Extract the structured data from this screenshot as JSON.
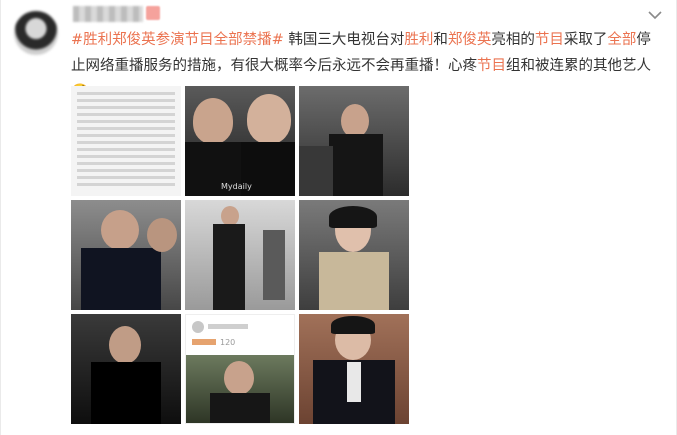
{
  "post": {
    "hashtag": "#胜利郑俊英参演节目全部禁播#",
    "segments": [
      {
        "text": " 韩国三大电视台对",
        "link": false
      },
      {
        "text": "胜利",
        "link": true
      },
      {
        "text": "和",
        "link": false
      },
      {
        "text": "郑俊英",
        "link": true
      },
      {
        "text": "亮相的",
        "link": false
      },
      {
        "text": "节目",
        "link": true
      },
      {
        "text": "采取了",
        "link": false
      },
      {
        "text": "全部",
        "link": true
      },
      {
        "text": "停止网络重播服务的措施，有很大概率今后永远不会再重播！心疼",
        "link": false
      },
      {
        "text": "节目",
        "link": true
      },
      {
        "text": "组和被连累的其他艺人",
        "link": false
      }
    ],
    "emoji": "🤤"
  },
  "images": [
    {
      "caption": ""
    },
    {
      "caption": "Mydaily"
    },
    {
      "caption": ""
    },
    {
      "caption": ""
    },
    {
      "caption": ""
    },
    {
      "caption": ""
    },
    {
      "caption": ""
    },
    {
      "caption": "120"
    },
    {
      "caption": ""
    }
  ],
  "colors": {
    "link": "#eb7350",
    "text": "#333333"
  }
}
